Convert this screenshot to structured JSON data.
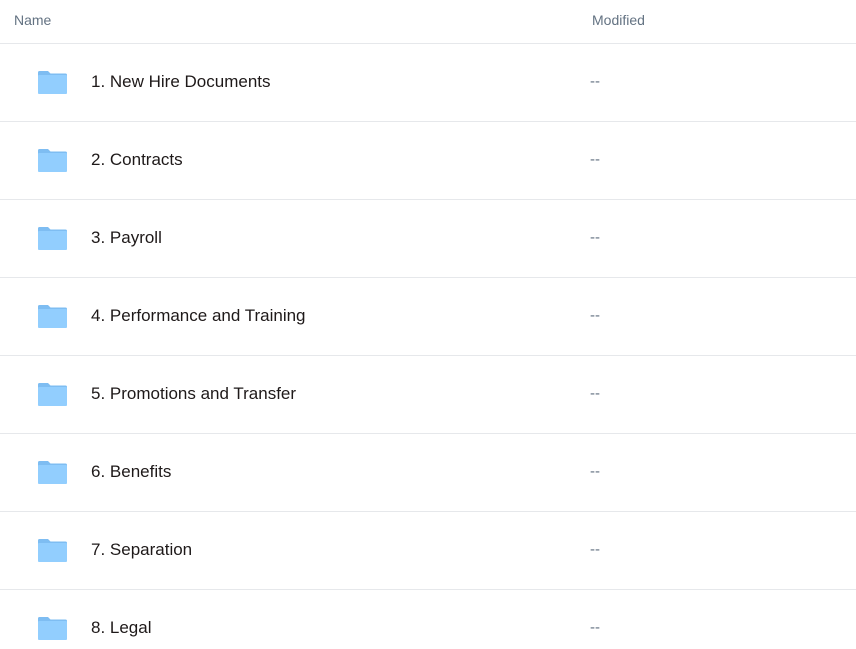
{
  "header": {
    "name_label": "Name",
    "modified_label": "Modified"
  },
  "colors": {
    "folder": "#92cefe",
    "folder_tab": "#7ebdf2",
    "divider": "#e6e8eb",
    "muted_text": "#637282"
  },
  "folders": [
    {
      "name": "1. New Hire Documents",
      "modified": "--",
      "icon": "folder-icon"
    },
    {
      "name": "2. Contracts",
      "modified": "--",
      "icon": "folder-icon"
    },
    {
      "name": "3. Payroll",
      "modified": "--",
      "icon": "folder-icon"
    },
    {
      "name": "4. Performance and Training",
      "modified": "--",
      "icon": "folder-icon"
    },
    {
      "name": "5. Promotions and Transfer",
      "modified": "--",
      "icon": "folder-icon"
    },
    {
      "name": "6. Benefits",
      "modified": "--",
      "icon": "folder-icon"
    },
    {
      "name": "7. Separation",
      "modified": "--",
      "icon": "folder-icon"
    },
    {
      "name": "8. Legal",
      "modified": "--",
      "icon": "folder-icon"
    }
  ]
}
